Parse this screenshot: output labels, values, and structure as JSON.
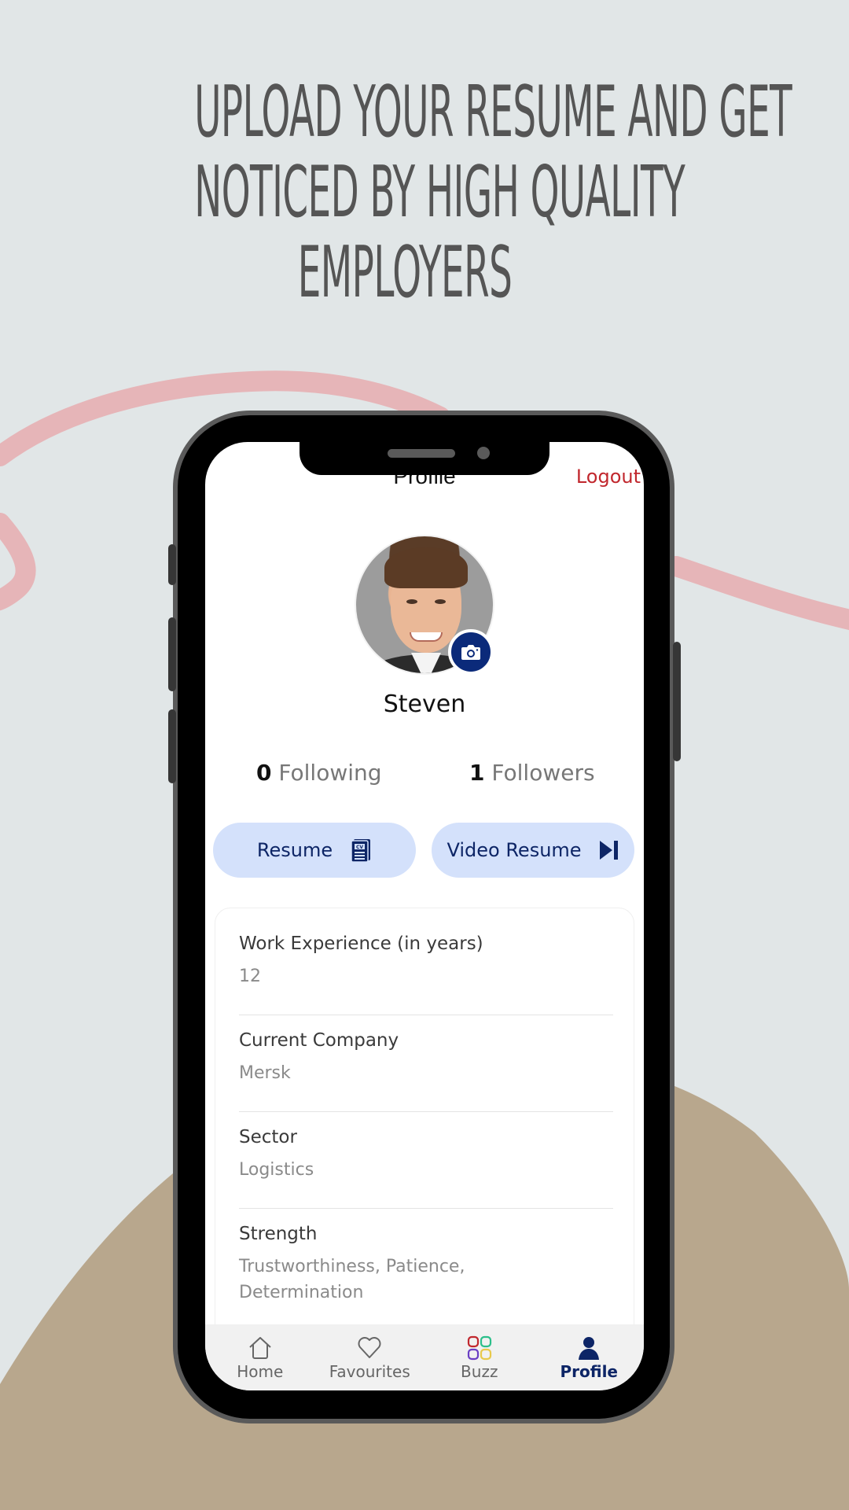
{
  "headline": {
    "lines": [
      "Upload Your resume and get",
      "noticed by high quality",
      "employers"
    ]
  },
  "colors": {
    "background": "#e1e6e7",
    "accent_pink": "#e6b5b8",
    "tan_blob": "#b8a78d",
    "primary_navy": "#0d2566",
    "pill_bg": "#d4e1fb",
    "logout_red": "#c1272d"
  },
  "app": {
    "header": {
      "title": "Profile",
      "logout_label": "Logout"
    },
    "profile": {
      "name": "Steven",
      "avatar_icon": "avatar-photo",
      "camera_icon": "camera-icon"
    },
    "stats": {
      "following": {
        "count": "0",
        "label": "Following"
      },
      "followers": {
        "count": "1",
        "label": "Followers"
      }
    },
    "actions": {
      "resume": {
        "label": "Resume",
        "icon": "cv-document-icon"
      },
      "video_resume": {
        "label": "Video Resume",
        "icon": "skip-forward-icon"
      }
    },
    "details": [
      {
        "label": "Work Experience (in years)",
        "value": "12"
      },
      {
        "label": "Current Company",
        "value": "Mersk"
      },
      {
        "label": "Sector",
        "value": "Logistics"
      },
      {
        "label": "Strength",
        "value": "Trustworthiness, Patience, Determination"
      }
    ],
    "tabbar": [
      {
        "label": "Home",
        "icon": "home-icon",
        "active": false
      },
      {
        "label": "Favourites",
        "icon": "heart-icon",
        "active": false
      },
      {
        "label": "Buzz",
        "icon": "grid-icon",
        "active": false
      },
      {
        "label": "Profile",
        "icon": "person-icon",
        "active": true
      }
    ]
  }
}
